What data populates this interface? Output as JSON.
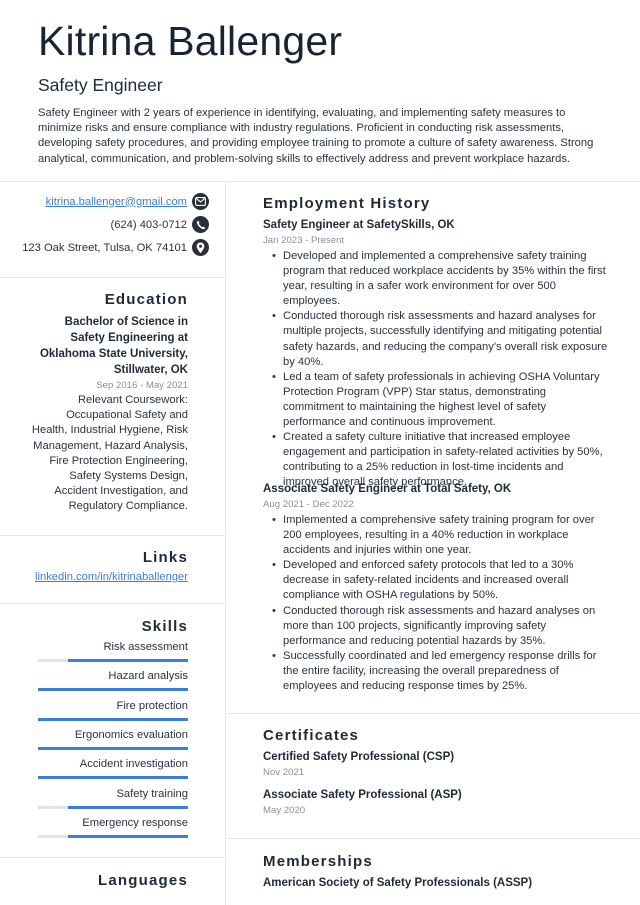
{
  "header": {
    "name": "Kitrina Ballenger",
    "title": "Safety Engineer",
    "summary": "Safety Engineer with 2 years of experience in identifying, evaluating, and implementing safety measures to minimize risks and ensure compliance with industry regulations. Proficient in conducting risk assessments, developing safety procedures, and providing employee training to promote a culture of safety awareness. Strong analytical, communication, and problem-solving skills to effectively address and prevent workplace hazards."
  },
  "contact": {
    "email": "kitrina.ballenger@gmail.com",
    "phone": "(624) 403-0712",
    "address": "123 Oak Street, Tulsa, OK 74101",
    "icons": [
      "envelope-icon",
      "phone-icon",
      "map-pin-icon"
    ]
  },
  "education": {
    "heading": "Education",
    "degree": "Bachelor of Science in Safety Engineering at Oklahoma State University, Stillwater, OK",
    "dates": "Sep 2016 - May 2021",
    "description": "Relevant Coursework: Occupational Safety and Health, Industrial Hygiene, Risk Management, Hazard Analysis, Fire Protection Engineering, Safety Systems Design, Accident Investigation, and Regulatory Compliance."
  },
  "links": {
    "heading": "Links",
    "items": [
      "linkedin.com/in/kitrinaballenger"
    ]
  },
  "skills": {
    "heading": "Skills",
    "items": [
      {
        "name": "Risk assessment",
        "level": 0.8
      },
      {
        "name": "Hazard analysis",
        "level": 1.0
      },
      {
        "name": "Fire protection",
        "level": 1.0
      },
      {
        "name": "Ergonomics evaluation",
        "level": 1.0
      },
      {
        "name": "Accident investigation",
        "level": 1.0
      },
      {
        "name": "Safety training",
        "level": 0.8
      },
      {
        "name": "Emergency response",
        "level": 0.8
      }
    ]
  },
  "languages": {
    "heading": "Languages"
  },
  "employment": {
    "heading": "Employment History",
    "jobs": [
      {
        "title": "Safety Engineer at SafetySkills, OK",
        "dates": "Jan 2023 - Present",
        "bullets": [
          "Developed and implemented a comprehensive safety training program that reduced workplace accidents by 35% within the first year, resulting in a safer work environment for over 500 employees.",
          "Conducted thorough risk assessments and hazard analyses for multiple projects, successfully identifying and mitigating potential safety hazards, and reducing the company's overall risk exposure by 40%.",
          "Led a team of safety professionals in achieving OSHA Voluntary Protection Program (VPP) Star status, demonstrating commitment to maintaining the highest level of safety performance and continuous improvement.",
          "Created a safety culture initiative that increased employee engagement and participation in safety-related activities by 50%, contributing to a 25% reduction in lost-time incidents and improved overall safety performance."
        ]
      },
      {
        "title": "Associate Safety Engineer at Total Safety, OK",
        "dates": "Aug 2021 - Dec 2022",
        "bullets": [
          "Implemented a comprehensive safety training program for over 200 employees, resulting in a 40% reduction in workplace accidents and injuries within one year.",
          "Developed and enforced safety protocols that led to a 30% decrease in safety-related incidents and increased overall compliance with OSHA regulations by 50%.",
          "Conducted thorough risk assessments and hazard analyses on more than 100 projects, significantly improving safety performance and reducing potential hazards by 35%.",
          "Successfully coordinated and led emergency response drills for the entire facility, increasing the overall preparedness of employees and reducing response times by 25%."
        ]
      }
    ]
  },
  "certificates": {
    "heading": "Certificates",
    "items": [
      {
        "name": "Certified Safety Professional (CSP)",
        "date": "Nov 2021"
      },
      {
        "name": "Associate Safety Professional (ASP)",
        "date": "May 2020"
      }
    ]
  },
  "memberships": {
    "heading": "Memberships",
    "items": [
      "American Society of Safety Professionals (ASSP)"
    ]
  },
  "colors": {
    "accent": "#3b7ddd",
    "name": "#1a2333",
    "muted": "#8b9098",
    "divider": "#e6e7ea"
  }
}
